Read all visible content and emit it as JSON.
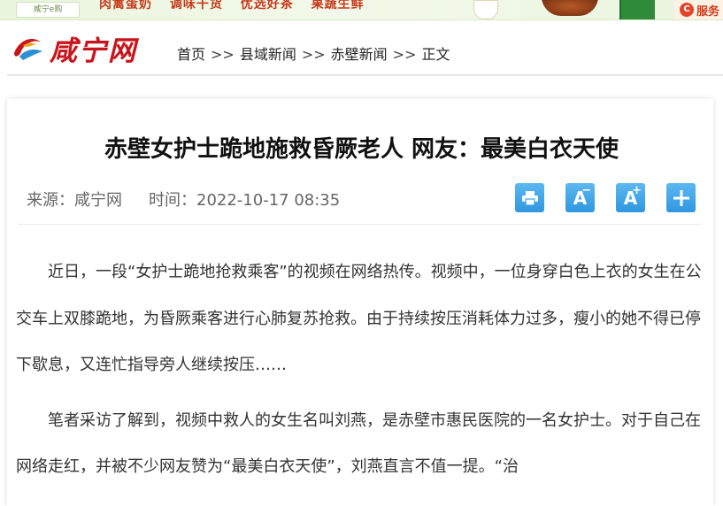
{
  "banner": {
    "shop_tag": "咸宁e购",
    "slogans": [
      "肉禽蛋奶",
      "调味干货",
      "优选好茶",
      "果蔬生鲜"
    ],
    "service_icon": "C",
    "service": "服务"
  },
  "site": {
    "logo_text": "咸宁网"
  },
  "breadcrumb": {
    "items": [
      "首页",
      "县域新闻",
      "赤壁新闻",
      "正文"
    ],
    "separator": ">>"
  },
  "article": {
    "title": "赤壁女护士跪地施救昏厥老人 网友：最美白衣天使",
    "source_label": "来源：咸宁网",
    "time_label": "时间：2022-10-17 08:35",
    "tools": [
      {
        "name": "print-icon"
      },
      {
        "name": "font-decrease-icon",
        "letter": "A",
        "sup": "−"
      },
      {
        "name": "font-increase-icon",
        "letter": "A",
        "sup": "+"
      },
      {
        "name": "share-plus-icon"
      }
    ],
    "paragraphs": [
      "近日，一段“女护士跪地抢救乘客”的视频在网络热传。视频中，一位身穿白色上衣的女生在公交车上双膝跪地，为昏厥乘客进行心肺复苏抢救。由于持续按压消耗体力过多，瘦小的她不得已停下歇息，又连忙指导旁人继续按压……",
      "笔者采访了解到，视频中救人的女生名叫刘燕，是赤壁市惠民医院的一名女护士。对于自己在网络走红，并被不少网友赞为“最美白衣天使”，刘燕直言不值一提。“治"
    ]
  },
  "colors": {
    "logo_red": "#c8141b",
    "tool_blue": "#3aa3e8",
    "banner_red": "#c63a1c"
  }
}
